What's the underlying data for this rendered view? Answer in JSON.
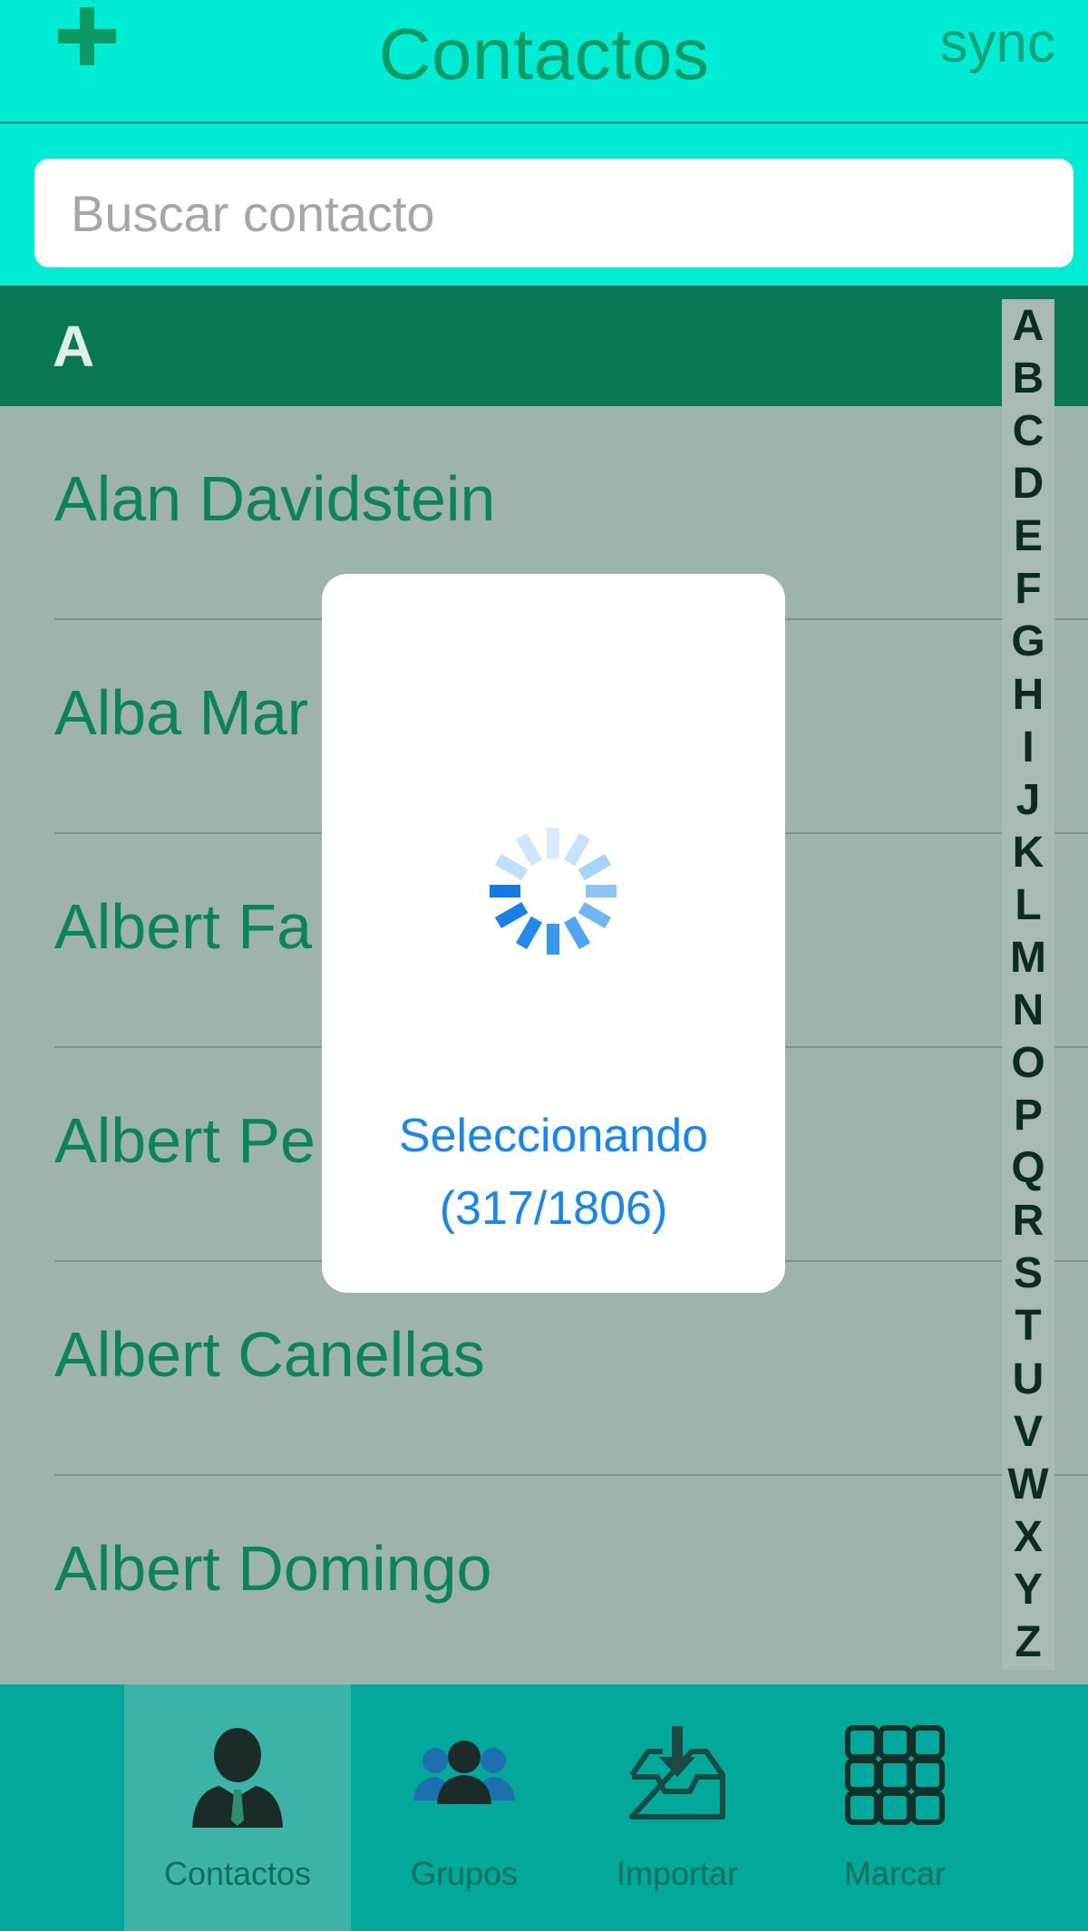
{
  "header": {
    "title": "Contactos",
    "add_icon": "plus-icon",
    "sync_label": "sync"
  },
  "search": {
    "placeholder": "Buscar contacto",
    "value": ""
  },
  "section": {
    "letter": "A"
  },
  "contacts": [
    {
      "name": "Alan Davidstein"
    },
    {
      "name": "Alba Mar"
    },
    {
      "name": "Albert Fa"
    },
    {
      "name": "Albert Pe"
    },
    {
      "name": "Albert Canellas"
    },
    {
      "name": "Albert Domingo"
    }
  ],
  "alphabet_index": [
    "A",
    "B",
    "C",
    "D",
    "E",
    "F",
    "G",
    "H",
    "I",
    "J",
    "K",
    "L",
    "M",
    "N",
    "O",
    "P",
    "Q",
    "R",
    "S",
    "T",
    "U",
    "V",
    "W",
    "X",
    "Y",
    "Z"
  ],
  "loading": {
    "icon": "spinner-icon",
    "line1": "Seleccionando",
    "line2": "(317/1806)",
    "color": "#1686f0"
  },
  "tabs": [
    {
      "label": "Contactos",
      "icon": "person-icon",
      "active": true
    },
    {
      "label": "Grupos",
      "icon": "group-icon",
      "active": false
    },
    {
      "label": "Importar",
      "icon": "inbox-download-icon",
      "active": false
    },
    {
      "label": "Marcar",
      "icon": "keypad-grid-icon",
      "active": false
    }
  ],
  "colors": {
    "header_bg": "#00ecd4",
    "section_bg": "#077853",
    "list_bg": "#9fb3ae",
    "text_green": "#0c8459",
    "tabbar_bg": "#02a99a"
  }
}
